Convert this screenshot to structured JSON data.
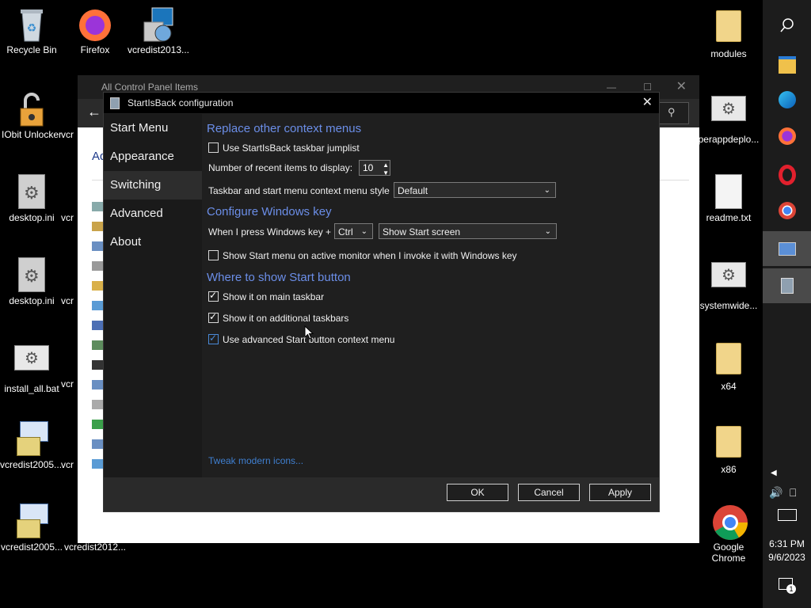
{
  "desktop": {
    "icons_left": [
      {
        "label": "Recycle Bin",
        "icon": "recycle-bin-icon"
      },
      {
        "label": "Firefox",
        "icon": "firefox-icon"
      },
      {
        "label": "vcredist2013...",
        "icon": "installer-icon"
      },
      {
        "label": "IObit Unlocker",
        "icon": "unlocker-icon"
      },
      {
        "label": "vcr",
        "icon": "installer-icon"
      },
      {
        "label": "desktop.ini",
        "icon": "settings-file-icon"
      },
      {
        "label": "vcr",
        "icon": "installer-icon"
      },
      {
        "label": "desktop.ini",
        "icon": "settings-file-icon"
      },
      {
        "label": "vcr",
        "icon": "installer-icon"
      },
      {
        "label": "install_all.bat",
        "icon": "batch-file-icon"
      },
      {
        "label": "vcr",
        "icon": "installer-icon"
      },
      {
        "label": "vcredist2005....",
        "icon": "installer-icon"
      },
      {
        "label": "vcr",
        "icon": "installer-icon"
      },
      {
        "label": "vcredist2005...",
        "icon": "installer-icon"
      },
      {
        "label": "vcredist2012...",
        "icon": "installer-icon"
      }
    ],
    "icons_right": [
      {
        "label": "modules",
        "icon": "folder-icon"
      },
      {
        "label": "perappdeplo...",
        "icon": "batch-file-icon"
      },
      {
        "label": "readme.txt",
        "icon": "text-file-icon"
      },
      {
        "label": "systemwide...",
        "icon": "batch-file-icon"
      },
      {
        "label": "x64",
        "icon": "folder-icon"
      },
      {
        "label": "x86",
        "icon": "folder-icon"
      },
      {
        "label": "Google Chrome",
        "icon": "chrome-icon"
      }
    ]
  },
  "control_panel": {
    "title": "All Control Panel Items",
    "heading_partial": "Ad"
  },
  "dialog": {
    "title": "StartIsBack configuration",
    "sidebar": [
      "Start Menu",
      "Appearance",
      "Switching",
      "Advanced",
      "About"
    ],
    "active_tab": "Switching",
    "sections": {
      "context_menus": "Replace other context menus",
      "windows_key": "Configure Windows key",
      "start_button": "Where to show Start button"
    },
    "jumplist_label": "Use StartIsBack taskbar jumplist",
    "recent_items_label": "Number of recent items to display:",
    "recent_items_value": "10",
    "context_style_label": "Taskbar and start menu context menu style",
    "context_style_value": "Default",
    "win_key_label": "When I press Windows key +",
    "win_key_modifier": "Ctrl",
    "win_key_action": "Show Start screen",
    "active_monitor_label": "Show Start menu on active monitor when I invoke it with Windows key",
    "main_taskbar_label": "Show it on main taskbar",
    "additional_taskbars_label": "Show it on additional taskbars",
    "advanced_context_label": "Use advanced Start button context menu",
    "tweak_link": "Tweak modern icons...",
    "ok": "OK",
    "cancel": "Cancel",
    "apply": "Apply"
  },
  "taskbar": {
    "time": "6:31 PM",
    "date": "9/6/2023",
    "notification_count": "1"
  },
  "colors": {
    "section_blue": "#6b8ee8",
    "link_blue": "#3f7fd0",
    "dialog_bg": "#1f1f1f"
  }
}
